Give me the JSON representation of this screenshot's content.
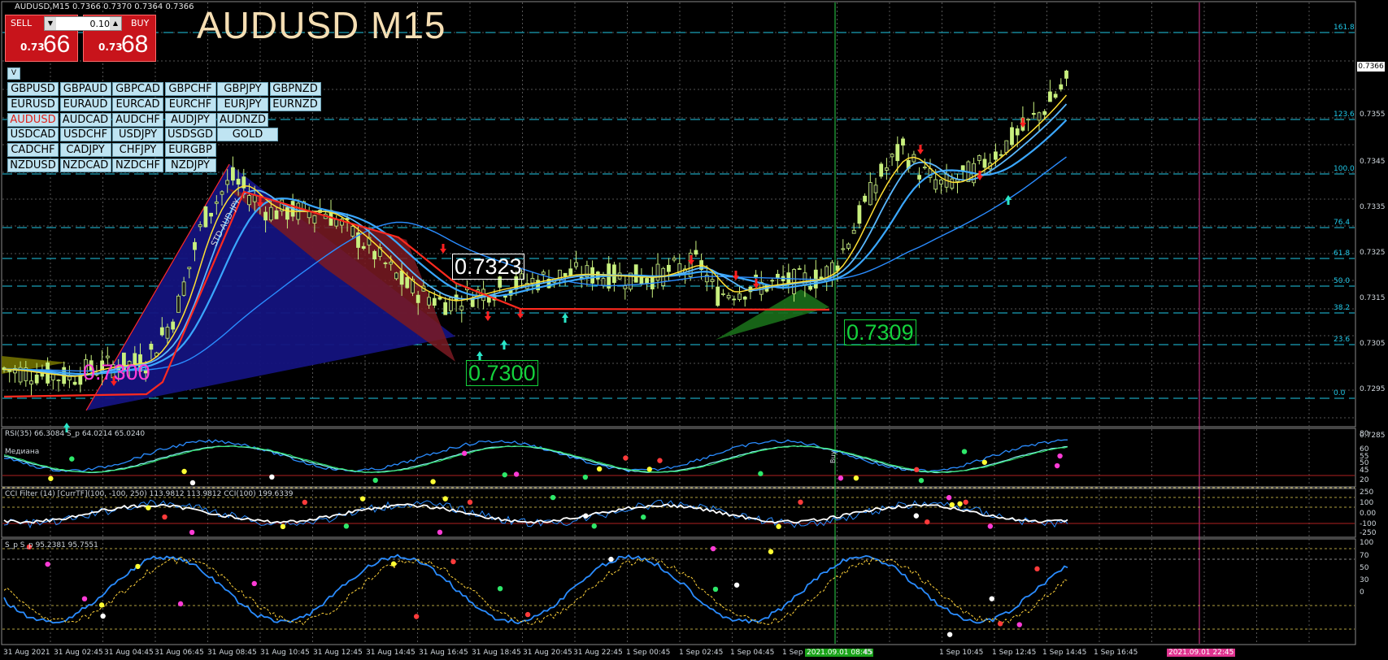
{
  "symbol_header": "AUDUSD,M15  0.7366 0.7370 0.7364 0.7366",
  "chart_title": "AUDUSD M15",
  "trade_panel": {
    "sell_label": "SELL",
    "buy_label": "BUY",
    "lot": "0.10",
    "sell_prefix": "0.73",
    "sell_big": "66",
    "buy_prefix": "0.73",
    "buy_big": "68",
    "down_arrow": "▼",
    "up_arrow": "▲"
  },
  "toggle_label": "V",
  "pairs": [
    [
      "GBPUSD",
      "GBPAUD",
      "GBPCAD",
      "GBPCHF",
      "GBPJPY",
      "GBPNZD"
    ],
    [
      "EURUSD",
      "EURAUD",
      "EURCAD",
      "EURCHF",
      "EURJPY",
      "EURNZD"
    ],
    [
      "AUDUSD",
      "AUDCAD",
      "AUDCHF",
      "AUDJPY",
      "AUDNZD"
    ],
    [
      "USDCAD",
      "USDCHF",
      "USDJPY",
      "USDSGD",
      "GOLD"
    ],
    [
      "CADCHF",
      "CADJPY",
      "CHFJPY",
      "EURGBP"
    ],
    [
      "NZDUSD",
      "NZDCAD",
      "NZDCHF",
      "NZDJPY"
    ]
  ],
  "active_pair": "AUDUSD",
  "price_axis": [
    "0.7366",
    "0.7355",
    "0.7345",
    "0.7335",
    "0.7325",
    "0.7315",
    "0.7305",
    "0.7295",
    "0.7285"
  ],
  "current_price": "0.7366",
  "fib_levels": [
    "161.8",
    "123.6",
    "100.0",
    "76.4",
    "61.8",
    "50.0",
    "38.2",
    "23.6",
    "0.0"
  ],
  "price_tags": {
    "left_low": "0.7300",
    "top": "0.7323",
    "mid_low": "0.7300",
    "right": "0.7309"
  },
  "pattern_label": "STD-AUD-JPY",
  "buy_marker": "Buy",
  "time_axis": [
    "31 Aug 2021",
    "31 Aug 02:45",
    "31 Aug 04:45",
    "31 Aug 06:45",
    "31 Aug 08:45",
    "31 Aug 10:45",
    "31 Aug 12:45",
    "31 Aug 14:45",
    "31 Aug 16:45",
    "31 Aug 18:45",
    "31 Aug 20:45",
    "31 Aug 22:45",
    "1 Sep 00:45",
    "1 Sep 02:45",
    "1 Sep 04:45",
    "1 Sep",
    "2021.09.01 08:45",
    "45",
    "1 Sep 10:45",
    "1 Sep 12:45",
    "1 Sep 14:45",
    "1 Sep 16:45"
  ],
  "future_time_tag": "2021.09.01 22:45",
  "rsi": {
    "title": "RSI(35) 66.3084  S_p 64.0214 65.0240",
    "sublabel": "Медиана",
    "levels": [
      "80",
      "60",
      "55",
      "50",
      "45",
      "20"
    ]
  },
  "cci": {
    "title": "CCI Filter (14) [CurrTF](100, -100, 250) 113.9812 113.9812  CCI(100) 199.6339",
    "levels": [
      "250",
      "100",
      "0.00",
      "-100",
      "-250"
    ]
  },
  "stoch": {
    "title": "S_p  S_p 95.2381 95.7551",
    "levels": [
      "100",
      "70",
      "50",
      "30",
      "0"
    ]
  },
  "colors": {
    "fib": "#1fc7e6",
    "candle_up": "#c8f07e",
    "candle_down": "#1e1e1e",
    "ma_red": "#ff2a1f",
    "ma_yellow": "#ffe033",
    "ma_blue": "#2a8cff",
    "tag_magenta": "#ff3bd6",
    "tag_green": "#14d23c",
    "vertical_green": "#2bd64b",
    "vertical_magenta": "#e0338f"
  }
}
